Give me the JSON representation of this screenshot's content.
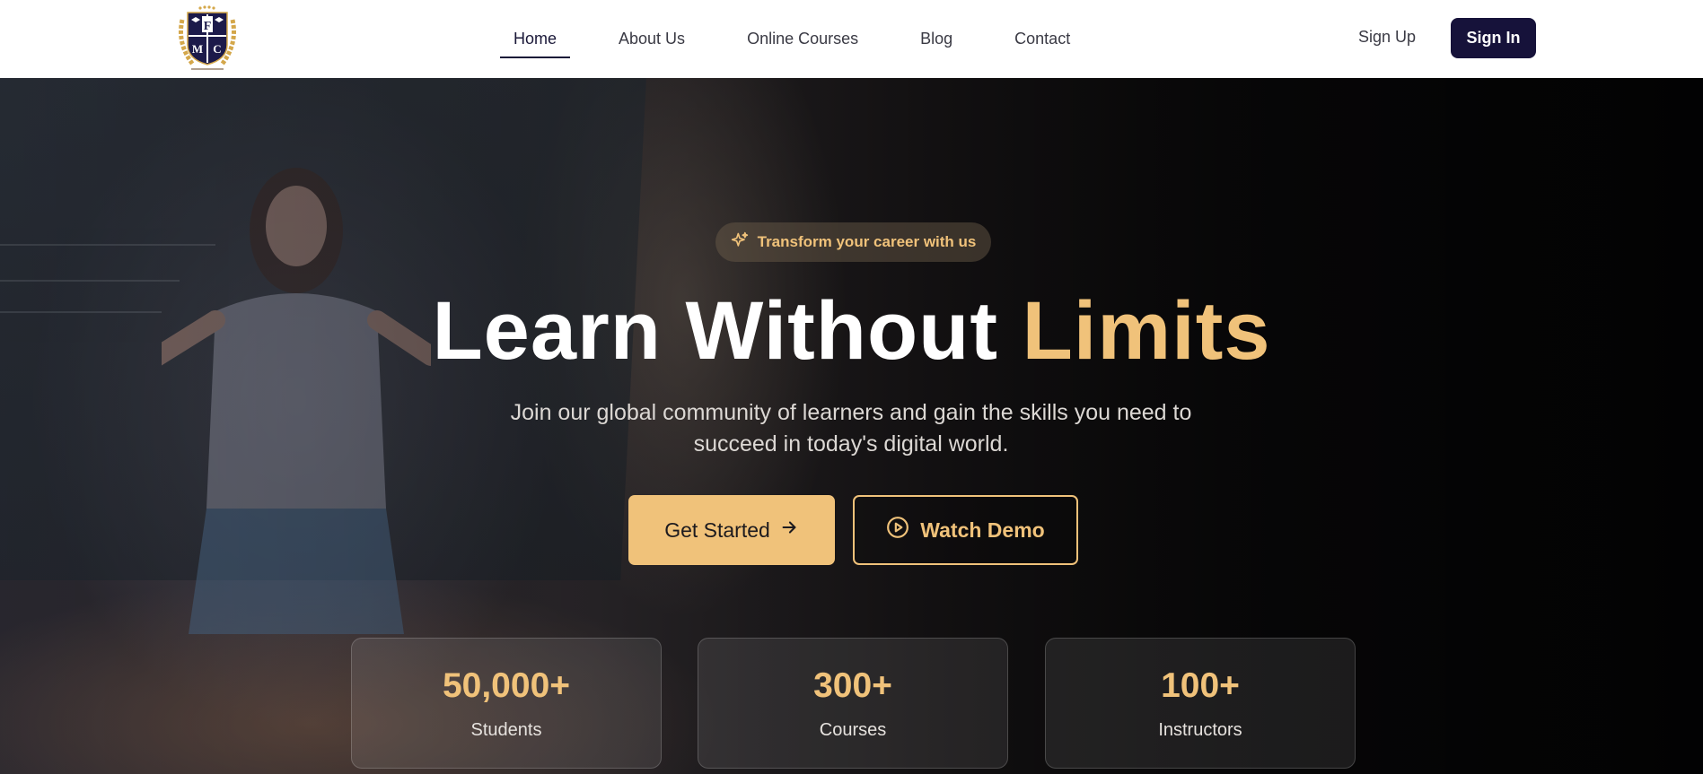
{
  "brand": {
    "logo_letters": [
      "F",
      "M",
      "C"
    ]
  },
  "nav": {
    "items": [
      {
        "label": "Home",
        "active": true
      },
      {
        "label": "About Us",
        "active": false
      },
      {
        "label": "Online Courses",
        "active": false
      },
      {
        "label": "Blog",
        "active": false
      },
      {
        "label": "Contact",
        "active": false
      }
    ],
    "signup_label": "Sign Up",
    "signin_label": "Sign In"
  },
  "hero": {
    "badge_text": "Transform your career with us",
    "title_main": "Learn Without",
    "title_accent": "Limits",
    "subtitle": "Join our global community of learners and gain the skills you need to succeed in today's digital world.",
    "primary_button": "Get Started",
    "secondary_button": "Watch Demo"
  },
  "stats": [
    {
      "value": "50,000+",
      "label": "Students"
    },
    {
      "value": "300+",
      "label": "Courses"
    },
    {
      "value": "100+",
      "label": "Instructors"
    }
  ],
  "colors": {
    "accent": "#f0c27a",
    "brand_dark": "#16123a"
  },
  "icons": {
    "badge": "sparkles-icon",
    "primary": "arrow-right-icon",
    "secondary": "play-circle-icon"
  }
}
